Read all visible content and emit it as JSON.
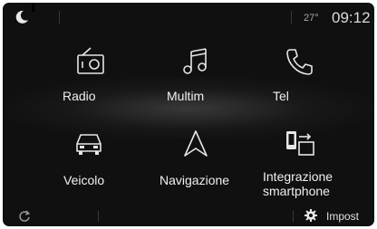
{
  "status_bar": {
    "temperature": "27°",
    "time": "09:12"
  },
  "menu": {
    "items": [
      {
        "label": "Radio",
        "icon": "radio-icon"
      },
      {
        "label": "Multim",
        "icon": "music-note-icon"
      },
      {
        "label": "Tel",
        "icon": "phone-icon"
      },
      {
        "label": "Veicolo",
        "icon": "car-icon"
      },
      {
        "label": "Navigazione",
        "icon": "navigation-arrow-icon"
      },
      {
        "label_line1": "Integrazione",
        "label_line2": "smartphone",
        "icon": "smartphone-mirroring-icon"
      }
    ]
  },
  "bottom_bar": {
    "settings_label": "Impost"
  },
  "colors": {
    "background": "#101010",
    "text": "#f0f0f0",
    "icon": "#e6e6e6"
  }
}
